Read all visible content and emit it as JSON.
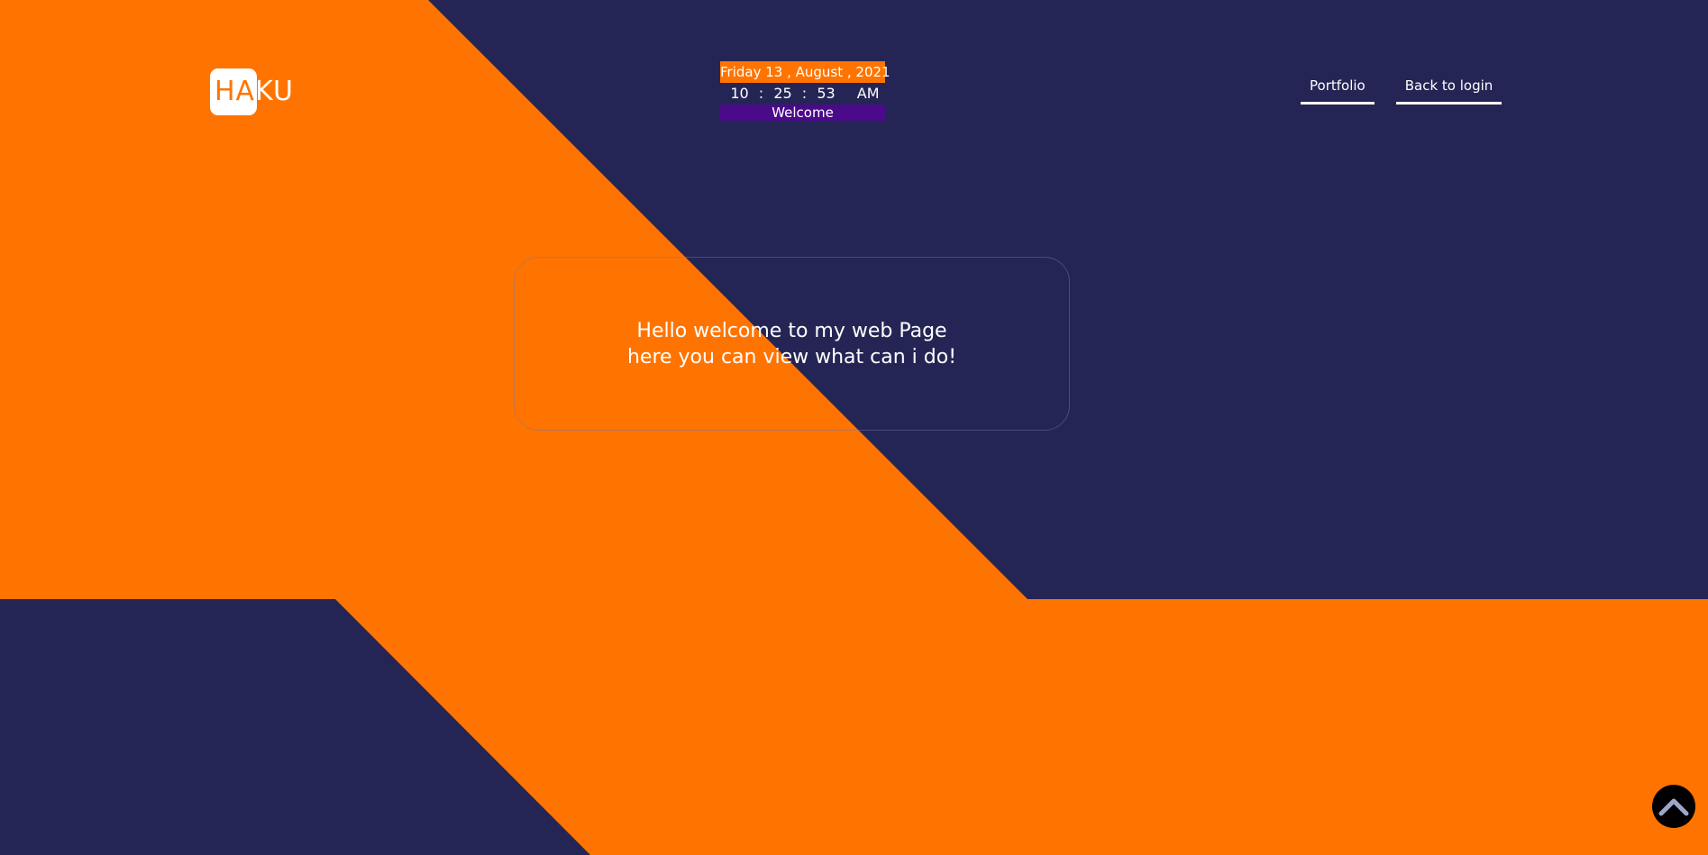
{
  "logo": {
    "text_part1": "HA",
    "text_part2": "KU"
  },
  "clock": {
    "date": "Friday 13 , August , 2021",
    "hours": "10",
    "minutes": "25",
    "seconds": "53",
    "separator": ":",
    "ampm": "AM",
    "welcome": "Welcome"
  },
  "nav": {
    "items": [
      {
        "label": "Portfolio"
      },
      {
        "label": "Back to login"
      }
    ]
  },
  "hero": {
    "line1": "Hello welcome to my web Page",
    "line2": "here you can view what can i do!"
  },
  "scroll_top": {
    "icon": "chevron-up-icon"
  },
  "colors": {
    "navy": "#252555",
    "orange": "#ff7400",
    "purple": "#4b0a8a"
  }
}
